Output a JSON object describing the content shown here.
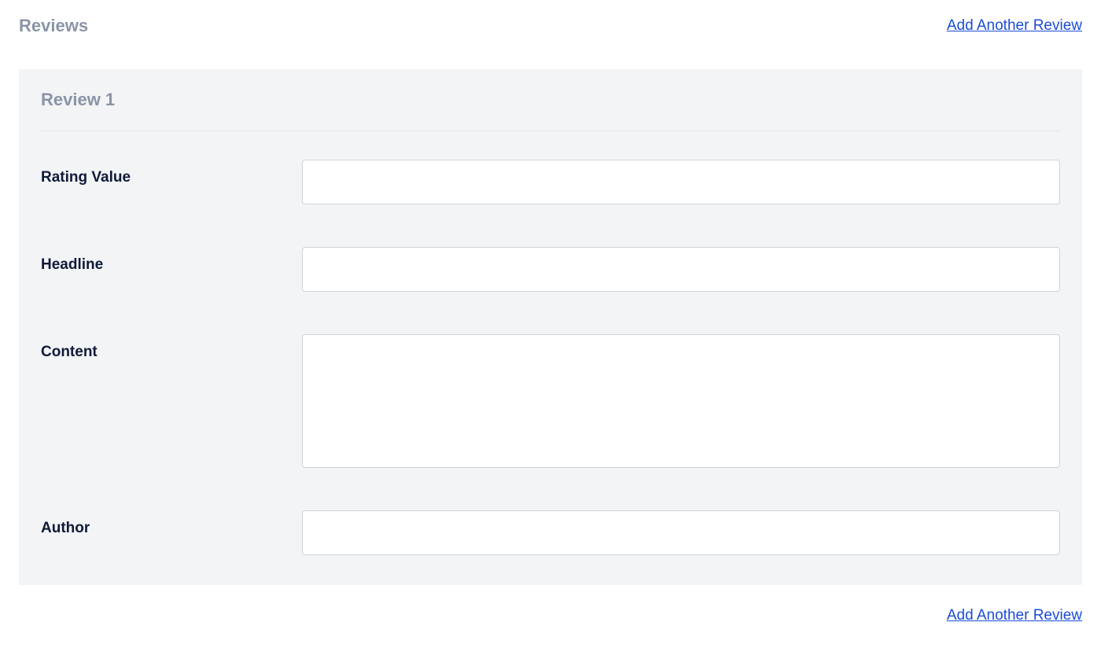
{
  "header": {
    "title": "Reviews",
    "addLink": "Add Another Review"
  },
  "review": {
    "title": "Review 1",
    "fields": {
      "ratingValue": {
        "label": "Rating Value",
        "value": ""
      },
      "headline": {
        "label": "Headline",
        "value": ""
      },
      "content": {
        "label": "Content",
        "value": ""
      },
      "author": {
        "label": "Author",
        "value": ""
      }
    }
  },
  "footer": {
    "addLink": "Add Another Review"
  }
}
